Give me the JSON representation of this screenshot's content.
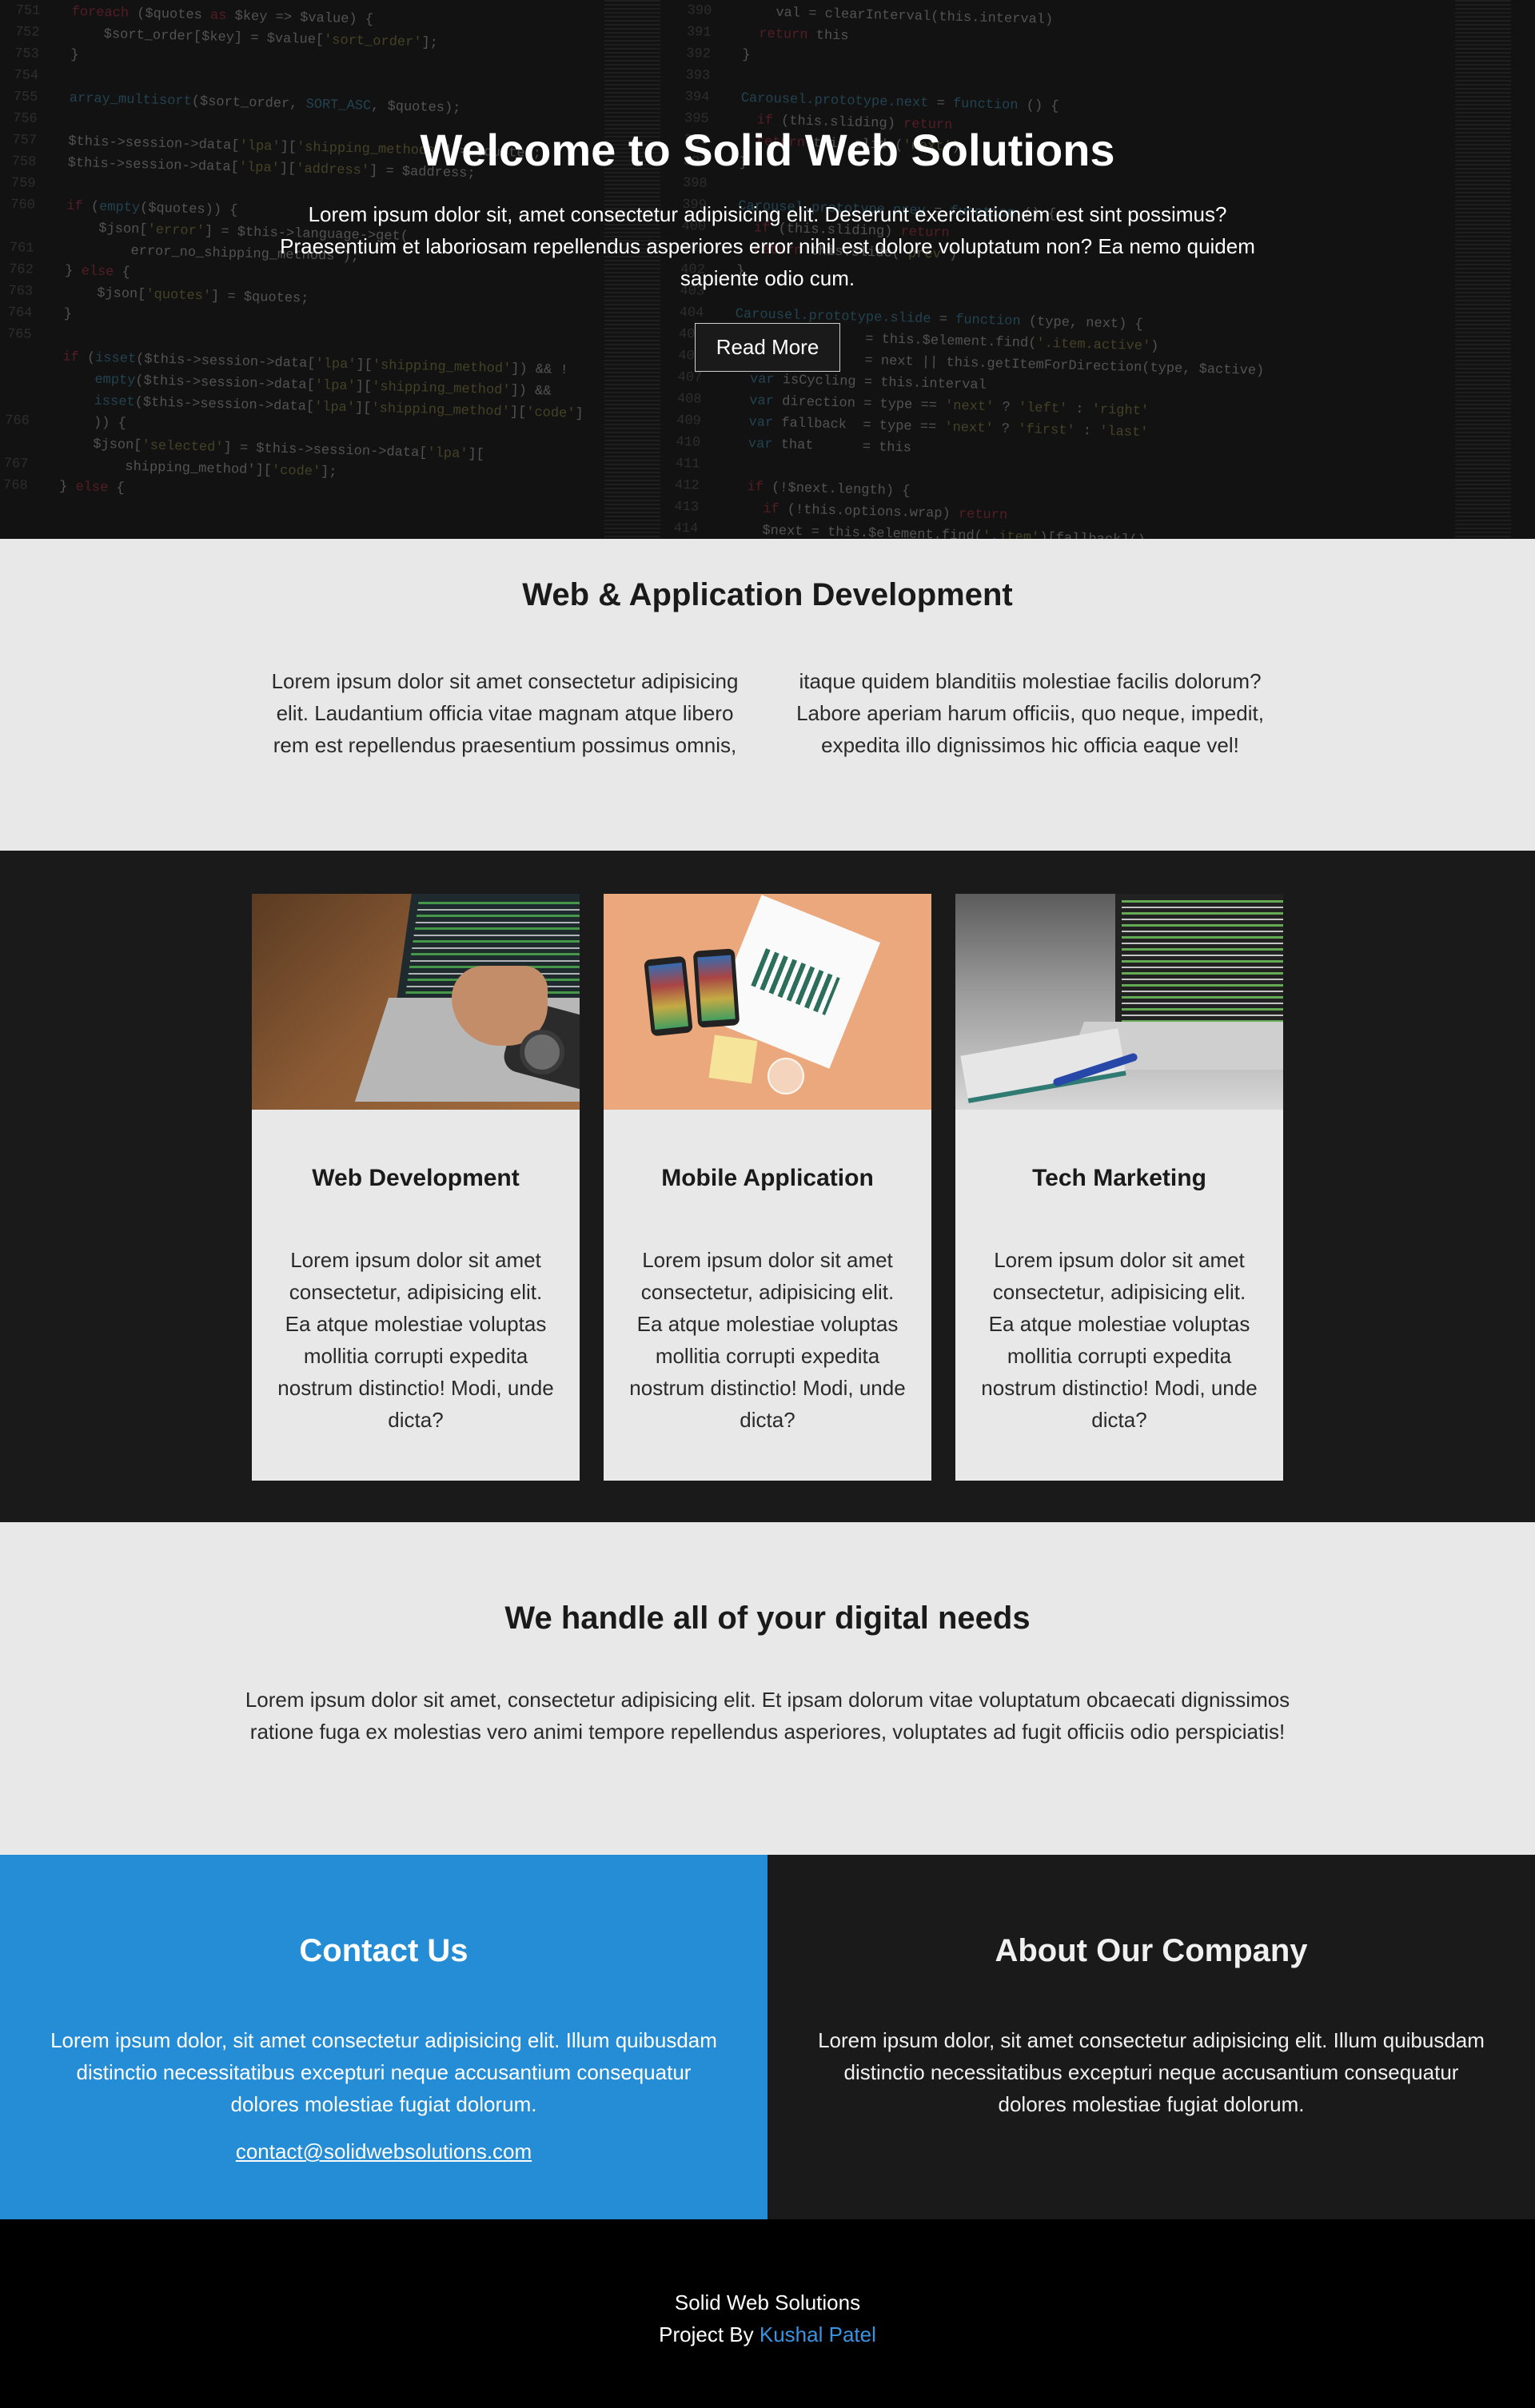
{
  "hero": {
    "title": "Welcome to Solid Web Solutions",
    "text": "Lorem ipsum dolor sit, amet consectetur adipisicing elit. Deserunt exercitationem est sint possimus? Praesentium et laboriosam repellendus asperiores error nihil est dolore voluptatum non? Ea nemo quidem sapiente odio cum.",
    "button_label": "Read More"
  },
  "services_intro": {
    "title": "Web & Application Development",
    "text": "Lorem ipsum dolor sit amet consectetur adipisicing elit. Laudantium officia vitae magnam atque libero rem est repellendus praesentium possimus omnis, itaque quidem blanditiis molestiae facilis dolorum? Labore aperiam harum officiis, quo neque, impedit, expedita illo dignissimos hic officia eaque vel!"
  },
  "cards": [
    {
      "title": "Web Development",
      "text": "Lorem ipsum dolor sit amet consectetur, adipisicing elit. Ea atque molestiae voluptas mollitia corrupti expedita nostrum distinctio! Modi, unde dicta?"
    },
    {
      "title": "Mobile Application",
      "text": "Lorem ipsum dolor sit amet consectetur, adipisicing elit. Ea atque molestiae voluptas mollitia corrupti expedita nostrum distinctio! Modi, unde dicta?"
    },
    {
      "title": "Tech Marketing",
      "text": "Lorem ipsum dolor sit amet consectetur, adipisicing elit. Ea atque molestiae voluptas mollitia corrupti expedita nostrum distinctio! Modi, unde dicta?"
    }
  ],
  "digital_needs": {
    "title": "We handle all of your digital needs",
    "text": "Lorem ipsum dolor sit amet, consectetur adipisicing elit. Et ipsam dolorum vitae voluptatum obcaecati dignissimos ratione fuga ex molestias vero animi tempore repellendus asperiores, voluptates ad fugit officiis odio perspiciatis!"
  },
  "contact": {
    "title": "Contact Us",
    "text": "Lorem ipsum dolor, sit amet consectetur adipisicing elit. Illum quibusdam distinctio necessitatibus excepturi neque accusantium consequatur dolores molestiae fugiat dolorum.",
    "email": "contact@solidwebsolutions.com"
  },
  "about": {
    "title": "About Our Company",
    "text": "Lorem ipsum dolor, sit amet consectetur adipisicing elit. Illum quibusdam distinctio necessitatibus excepturi neque accusantium consequatur dolores molestiae fugiat dolorum."
  },
  "footer": {
    "company": "Solid Web Solutions",
    "credit_prefix": "Project By",
    "author": "Kushal Patel"
  },
  "colors": {
    "accent_blue": "#258dd5",
    "dark": "#1a1a1a",
    "light": "#e8e8e8",
    "footer_link": "#3a93e0"
  },
  "images": {
    "card_1": "laptop-typing-photo",
    "card_2": "phones-and-charts-photo",
    "card_3": "laptop-notebook-photo",
    "hero_background": "code-editor-background"
  }
}
